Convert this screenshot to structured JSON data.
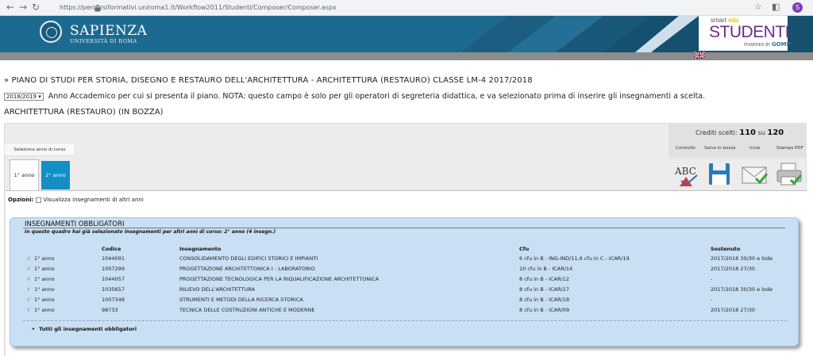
{
  "browser": {
    "url": "https://percorsiformativi.uniroma1.it/Workflow2011/Studenti/Composer/Composer.aspx"
  },
  "header": {
    "university_name": "Sapienza",
    "university_sub": "UNIVERSITÀ DI ROMA",
    "brand_top_1": "smart",
    "brand_top_2": "edu",
    "brand_main": "STUDENTI",
    "brand_sub_1": "POWERED BY",
    "brand_sub_2": "GOMP"
  },
  "page": {
    "title": "» PIANO DI STUDI PER STORIA, DISEGNO E RESTAURO DELL'ARCHITETTURA - ARCHITETTURA (RESTAURO) CLASSE LM-4 2017/2018",
    "year_value": "2018/2019",
    "year_note": "Anno Accademico per cui si presenta il piano. NOTA: questo campo è solo per gli operatori di segreteria didattica, e va selezionato prima di inserire gli insegnamenti a scelta.",
    "course_title": "ARCHITETTURA (RESTAURO) (IN BOZZA)"
  },
  "panel": {
    "tabs_header": "Seleziona anno di corso",
    "tabs": [
      "1° anno",
      "2° anno"
    ],
    "credits_label": "Crediti scelti:",
    "credits_value": "110",
    "credits_su": "su",
    "credits_total": "120",
    "actions": [
      "Controllo",
      "Salva in bozza",
      "Invia",
      "Stampa PDF"
    ]
  },
  "options": {
    "label": "Opzioni:",
    "checkbox_label": "Visualizza insegnamenti di altri anni"
  },
  "mandatory": {
    "title": "INSEGNAMENTI OBBLIGATORI",
    "subtitle": "In questo quadro hai già selezionato insegnamenti per altri anni di corso: 2° anno (4 insegn.)",
    "columns": [
      "Codice",
      "Insegnamento",
      "Cfu",
      "Sostenuto"
    ],
    "rows": [
      {
        "year": "1° anno",
        "code": "1044091",
        "name": "CONSOLIDAMENTO DEGLI EDIFICI STORICI E IMPIANTI",
        "cfu": "6 cfu in B - ING-IND/11,6 cfu in C - ICAR/19",
        "passed": "2017/2018 30/30 e lode"
      },
      {
        "year": "1° anno",
        "code": "1007299",
        "name": "PROGETTAZIONE ARCHITETTONICA I - LABORATORIO",
        "cfu": "10 cfu in B - ICAR/14",
        "passed": "2017/2018 27/30"
      },
      {
        "year": "1° anno",
        "code": "1044057",
        "name": "PROGETTAZIONE TECNOLOGICA PER LA RIQUALIFICAZIONE ARCHITETTONICA",
        "cfu": "8 cfu in B - ICAR/12",
        "passed": "-"
      },
      {
        "year": "1° anno",
        "code": "1035657",
        "name": "RILIEVO DELL'ARCHITETTURA",
        "cfu": "8 cfu in B - ICAR/17",
        "passed": "2017/2018 30/30 e lode"
      },
      {
        "year": "1° anno",
        "code": "1007348",
        "name": "STRUMENTI E METODI DELLA RICERCA STORICA",
        "cfu": "8 cfu in B - ICAR/18",
        "passed": "-"
      },
      {
        "year": "1° anno",
        "code": "98733",
        "name": "TECNICA DELLE COSTRUZIONI ANTICHE E MODERNE",
        "cfu": "8 cfu in B - ICAR/09",
        "passed": "2017/2018 27/30"
      }
    ],
    "all_link": "Tutti gli insegnamenti obbligatori"
  }
}
